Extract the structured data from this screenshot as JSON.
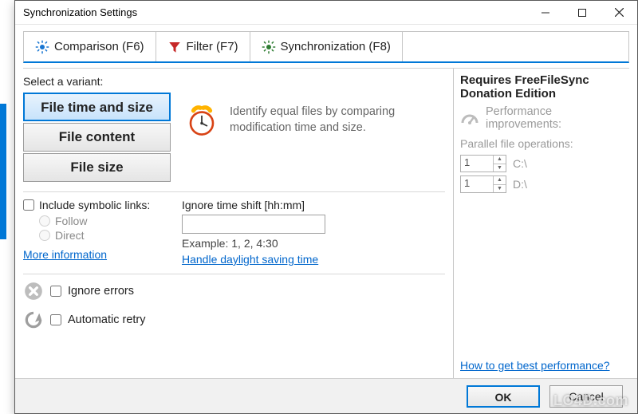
{
  "window": {
    "title": "Synchronization Settings"
  },
  "tabs": {
    "comparison": "Comparison (F6)",
    "filter": "Filter (F7)",
    "synchronization": "Synchronization (F8)"
  },
  "left": {
    "select_label": "Select a variant:",
    "variants": {
      "time_size": "File time and size",
      "content": "File content",
      "size": "File size"
    },
    "description": "Identify equal files by comparing modification time and size.",
    "symlinks": {
      "label": "Include symbolic links:",
      "follow": "Follow",
      "direct": "Direct",
      "more_info": "More information"
    },
    "timeshift": {
      "label": "Ignore time shift [hh:mm]",
      "value": "",
      "example": "Example: 1, 2, 4:30",
      "dst_link": "Handle daylight saving time"
    },
    "errors": {
      "ignore": "Ignore errors",
      "retry": "Automatic retry"
    }
  },
  "right": {
    "requires": "Requires FreeFileSync Donation Edition",
    "perf_title": "Performance improvements:",
    "parallel_label": "Parallel file operations:",
    "rows": [
      {
        "value": "1",
        "drive": "C:\\"
      },
      {
        "value": "1",
        "drive": "D:\\"
      }
    ],
    "best_perf": "How to get best performance?"
  },
  "buttons": {
    "ok": "OK",
    "cancel": "Cancel"
  },
  "watermark": "LO4D.com"
}
